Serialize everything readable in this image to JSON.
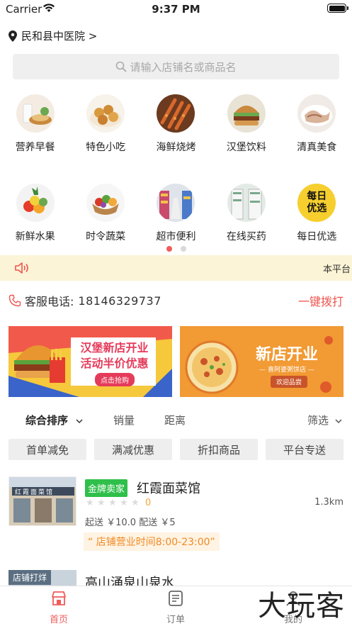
{
  "status_bar": {
    "carrier": "Carrier",
    "time": "9:37 PM"
  },
  "location": {
    "name": "民和县中医院 >"
  },
  "search": {
    "placeholder": "请输入店铺名或商品名"
  },
  "categories_row1": [
    {
      "label": "营养早餐",
      "icon": "breakfast-image"
    },
    {
      "label": "特色小吃",
      "icon": "snack-image"
    },
    {
      "label": "海鲜烧烤",
      "icon": "bbq-image"
    },
    {
      "label": "汉堡饮料",
      "icon": "burger-image"
    },
    {
      "label": "清真美食",
      "icon": "halal-food-image"
    }
  ],
  "categories_row2": [
    {
      "label": "新鲜水果",
      "icon": "fruit-image"
    },
    {
      "label": "时令蔬菜",
      "icon": "vegetable-image"
    },
    {
      "label": "超市便利",
      "icon": "supermarket-image"
    },
    {
      "label": "在线买药",
      "icon": "pharmacy-image"
    },
    {
      "label": "每日优选",
      "icon": "daily-pick-image"
    }
  ],
  "daily_pick_logo": {
    "line1": "每日",
    "line2": "优选"
  },
  "notice": {
    "text": "本平台"
  },
  "service": {
    "label": "客服电话:",
    "number": "18146329737",
    "call": "一键拨打"
  },
  "banners": [
    {
      "line1": "汉堡新店开业",
      "line2": "活动半价优惠",
      "button": "点击抢购"
    },
    {
      "title": "新店开业",
      "subtitle": "— 喜阿婆粥饼店 —",
      "button": "欢迎品尝"
    }
  ],
  "sort": {
    "comprehensive": "综合排序",
    "sales": "销量",
    "distance": "距离",
    "filter": "筛选"
  },
  "tags": [
    "首单减免",
    "满减优惠",
    "折扣商品",
    "平台专送"
  ],
  "shop": {
    "badge": "金牌卖家",
    "name": "红霞面菜馆",
    "rating": "0",
    "distance": "1.3km",
    "delivery": "起送 ￥10.0  配送 ￥5",
    "hours": "“ 店铺营业时间8:00-23:00”",
    "sign": "红霞面菜馆"
  },
  "shop2": {
    "badge": "店铺打烊",
    "name": "高山涌泉山泉水"
  },
  "tabs": [
    {
      "label": "首页",
      "icon": "home-icon"
    },
    {
      "label": "订单",
      "icon": "order-icon"
    },
    {
      "label": "我的",
      "icon": "profile-icon"
    }
  ],
  "watermark": "大玩客",
  "colors": {
    "accent": "#f05b5b",
    "gold_badge": "#2fbf4a",
    "notice_bg": "#fcf4d6",
    "hours_text": "#f08a24"
  }
}
